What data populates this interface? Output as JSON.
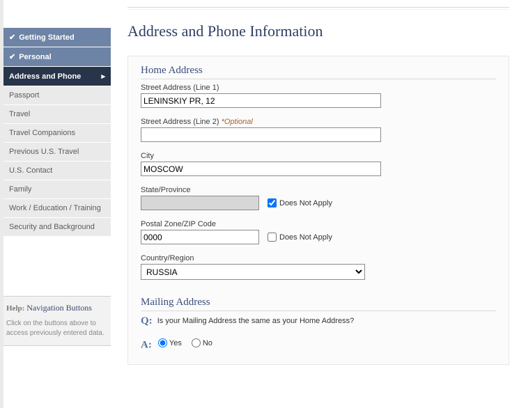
{
  "page": {
    "title": "Address and Phone Information"
  },
  "sidebar": {
    "items": [
      {
        "label": "Getting Started",
        "status": "completed"
      },
      {
        "label": "Personal",
        "status": "completed"
      },
      {
        "label": "Address and Phone",
        "status": "active"
      },
      {
        "label": "Passport",
        "status": "todo"
      },
      {
        "label": "Travel",
        "status": "todo"
      },
      {
        "label": "Travel Companions",
        "status": "todo"
      },
      {
        "label": "Previous U.S. Travel",
        "status": "todo"
      },
      {
        "label": "U.S. Contact",
        "status": "todo"
      },
      {
        "label": "Family",
        "status": "todo"
      },
      {
        "label": "Work / Education / Training",
        "status": "todo"
      },
      {
        "label": "Security and Background",
        "status": "todo"
      }
    ],
    "help": {
      "title_prefix": "Help:",
      "title": "Navigation Buttons",
      "text": "Click on the buttons above to access previously entered data."
    }
  },
  "form": {
    "home_address": {
      "section_title": "Home Address",
      "street1": {
        "label": "Street Address (Line 1)",
        "value": "LENINSKIY PR, 12"
      },
      "street2": {
        "label": "Street Address (Line 2) ",
        "optional": "*Optional",
        "value": ""
      },
      "city": {
        "label": "City",
        "value": "MOSCOW"
      },
      "state": {
        "label": "State/Province",
        "value": "",
        "dna_label": "Does Not Apply",
        "dna_checked": true
      },
      "postal": {
        "label": "Postal Zone/ZIP Code",
        "value": "0000",
        "dna_label": "Does Not Apply",
        "dna_checked": false
      },
      "country": {
        "label": "Country/Region",
        "value": "RUSSIA"
      }
    },
    "mailing_address": {
      "section_title": "Mailing Address",
      "q_prefix": "Q:",
      "question": "Is your Mailing Address the same as your Home Address?",
      "a_prefix": "A:",
      "yes_label": "Yes",
      "no_label": "No",
      "answer": "yes"
    }
  }
}
